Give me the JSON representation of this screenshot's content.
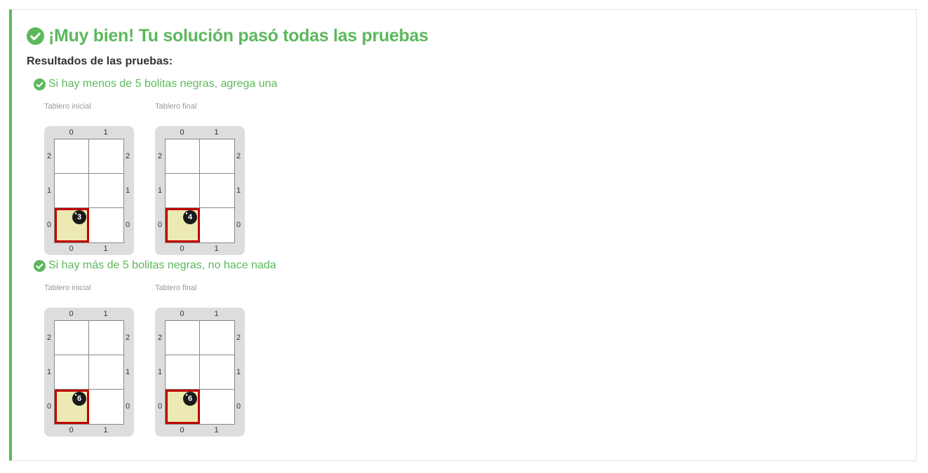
{
  "headline": "¡Muy bien! Tu solución pasó todas las pruebas",
  "results_label": "Resultados de las pruebas:",
  "colors": {
    "success": "#5cb85c",
    "head_cell": "#ece9b2",
    "cursor": "#c10000",
    "ball": "#1a1a1a"
  },
  "tests": [
    {
      "title": "Si hay menos de 5 bolitas negras, agrega una",
      "status": "passed",
      "boards": [
        {
          "label": "Tablero inicial",
          "black_balls_at_0_0": "3"
        },
        {
          "label": "Tablero final",
          "black_balls_at_0_0": "4"
        }
      ]
    },
    {
      "title": "Si hay más de 5 bolitas negras, no hace nada",
      "status": "passed",
      "boards": [
        {
          "label": "Tablero inicial",
          "black_balls_at_0_0": "6"
        },
        {
          "label": "Tablero final",
          "black_balls_at_0_0": "6"
        }
      ]
    }
  ],
  "board_axes": {
    "columns": [
      "0",
      "1"
    ],
    "rows": [
      "2",
      "1",
      "0"
    ]
  }
}
